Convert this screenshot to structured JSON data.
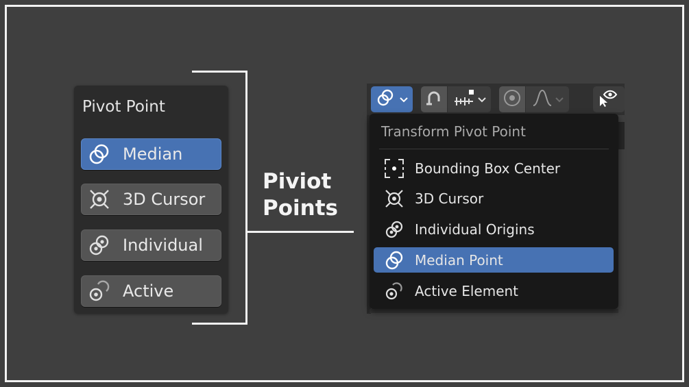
{
  "left_panel": {
    "title": "Pivot Point",
    "buttons": [
      {
        "label": "Median",
        "icon": "median-point-icon",
        "active": true
      },
      {
        "label": "3D Cursor",
        "icon": "3d-cursor-icon",
        "active": false
      },
      {
        "label": "Individual",
        "icon": "individual-origins-icon",
        "active": false
      },
      {
        "label": "Active",
        "icon": "active-element-icon",
        "active": false
      }
    ]
  },
  "callout": {
    "line1": "Piviot",
    "line2": "Points"
  },
  "menu": {
    "title": "Transform Pivot Point",
    "items": [
      {
        "label": "Bounding Box Center",
        "icon": "bounding-box-center-icon",
        "active": false
      },
      {
        "label": "3D Cursor",
        "icon": "3d-cursor-icon",
        "active": false
      },
      {
        "label": "Individual Origins",
        "icon": "individual-origins-icon",
        "active": false
      },
      {
        "label": "Median Point",
        "icon": "median-point-icon",
        "active": true
      },
      {
        "label": "Active Element",
        "icon": "active-element-icon",
        "active": false
      }
    ]
  },
  "toolbar": {
    "pivot_icon": "median-point-icon",
    "snap_icon": "magnet-icon",
    "snap_target_icon": "snap-increment-icon",
    "proportional_icon": "proportional-editing-icon",
    "falloff_icon": "falloff-curve-icon",
    "visibility_icon": "eye-cursor-icon"
  },
  "colors": {
    "accent": "#4772b3",
    "background": "#3f3f3f",
    "panel": "#2b2b2b",
    "button": "#545454",
    "menu": "#181818"
  }
}
